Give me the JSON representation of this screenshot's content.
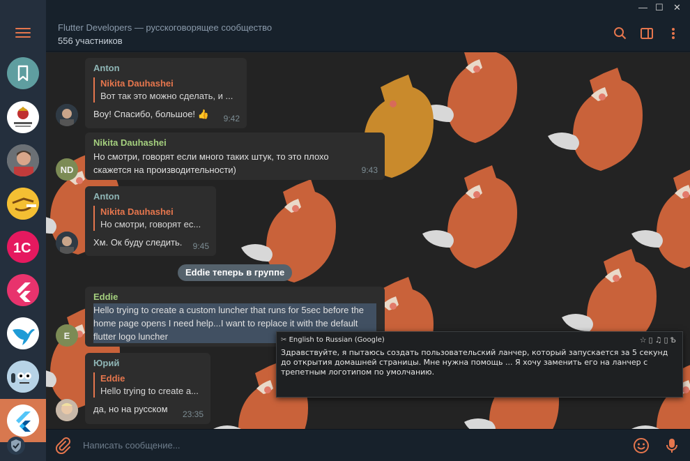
{
  "window": {
    "minimize": "—",
    "maximize": "☐",
    "close": "✕"
  },
  "header": {
    "title": "Flutter Developers — русскоговорящее сообщество",
    "subtitle": "556 участников"
  },
  "sidebar": {
    "menu_icon": "hamburger-menu-icon",
    "chats": [
      {
        "icon": "saved-messages-icon",
        "color": "#5f9ea0"
      },
      {
        "icon": "coat-of-arms-avatar",
        "color": "#ffffff"
      },
      {
        "icon": "person-avatar",
        "color": "#9aa0a6"
      },
      {
        "icon": "emoji-avatar",
        "color": "#f2b52c"
      },
      {
        "icon": "1c-avatar",
        "color": "#e5195f"
      },
      {
        "icon": "flutter-avatar",
        "color": "#e8336d"
      },
      {
        "icon": "hummingbird-avatar",
        "color": "#ffffff"
      },
      {
        "icon": "bug-mascot-avatar",
        "color": "#b7d3e6"
      },
      {
        "icon": "flutter-avatar-active",
        "color": "#ffffff"
      }
    ]
  },
  "messages": [
    {
      "author": "Anton",
      "author_color": "#8fb6b6",
      "quote_author": "Nikita Dauhashei",
      "quote_text": "Вот так это можно сделать, и ...",
      "text": "Воу! Спасибо, большое! 👍",
      "time": "9:42"
    },
    {
      "author": "Nikita Dauhashei",
      "author_color": "#a4cf7e",
      "avatar_initials": "ND",
      "text": "Но смотри, говорят если много таких штук, то это плохо скажется на производительности)",
      "time": "9:43"
    },
    {
      "author": "Anton",
      "author_color": "#8fb6b6",
      "quote_author": "Nikita Dauhashei",
      "quote_text": "Но смотри, говорят ес...",
      "text": "Хм. Ок буду следить.",
      "time": "9:45"
    },
    {
      "author": "Eddie",
      "author_color": "#a4cf7e",
      "avatar_initials": "E",
      "text": "Hello trying to create a custom luncher that runs for 5sec before the home page opens I need help...I want to replace it with the default flutter logo luncher"
    },
    {
      "author": "Юрий",
      "author_color": "#8fb6b6",
      "quote_author": "Eddie",
      "quote_text": "Hello trying to create a...",
      "text": "да, но на русском",
      "time": "23:35"
    }
  ],
  "service_message": "Eddie теперь в группе",
  "translation": {
    "title": "English to Russian (Google)",
    "tools": "☆▯♫▯Ѣ",
    "text": "Здравствуйте, я пытаюсь создать пользовательский ланчер, который запускается за 5 секунд до открытия домашней страницы. Мне нужна помощь ... Я хочу заменить его на ланчер с трепетным логотипом по умолчанию."
  },
  "composer": {
    "placeholder": "Написать сообщение..."
  },
  "colors": {
    "accent": "#e6764d",
    "chat_bg": "#232323",
    "bubble": "#2d2d2d",
    "fox_orange": "#c9623a",
    "fox_gold": "#c98a2c"
  }
}
